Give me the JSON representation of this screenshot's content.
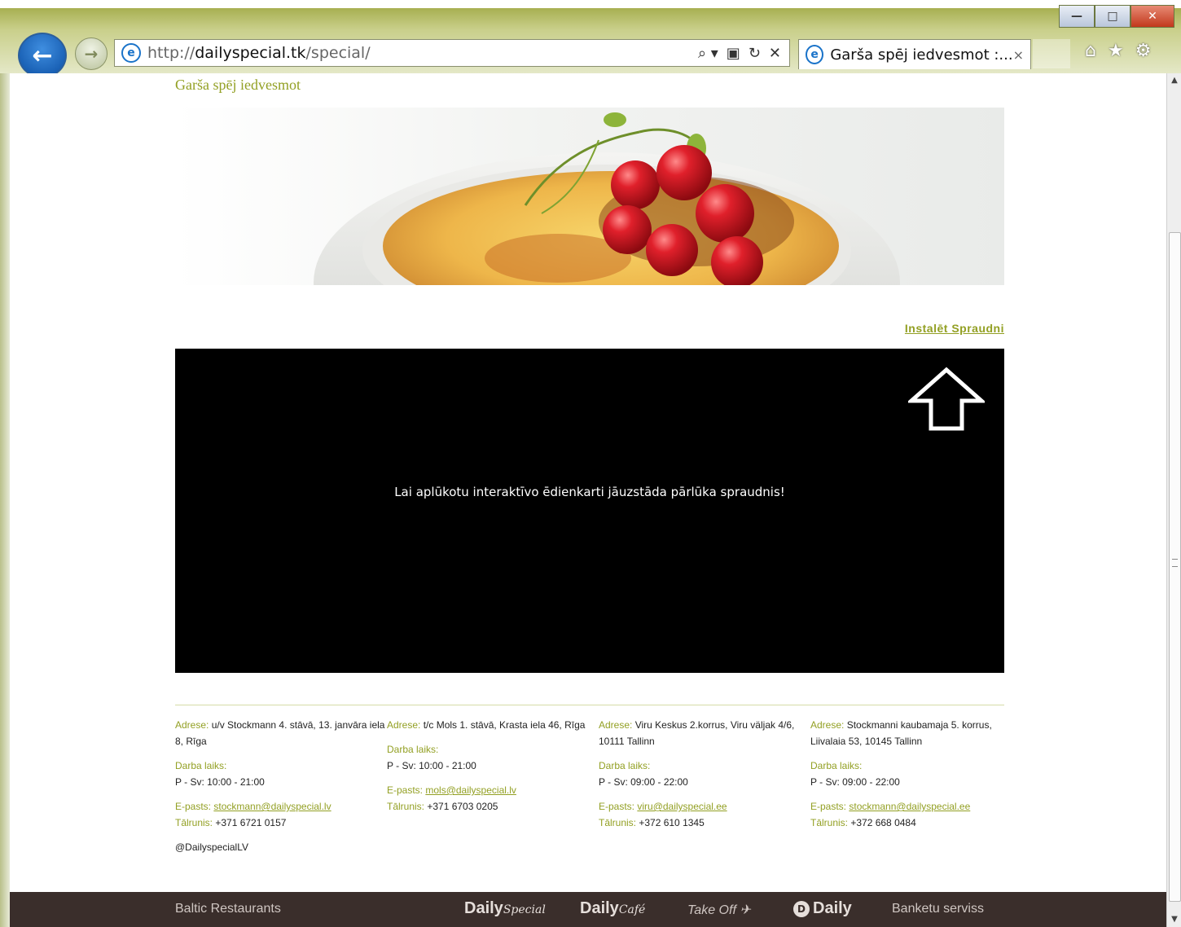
{
  "browser": {
    "url_scheme": "http://",
    "url_host": "dailyspecial.tk",
    "url_path": "/special/",
    "tab_title": "Garša spēj iedvesmot :...",
    "tab_close": "×",
    "addr_tools": {
      "search": "⌕ ▾",
      "compat": "▣",
      "refresh": "↻",
      "stop": "✕"
    },
    "window_buttons": {
      "minimize": "—",
      "restore": "□",
      "close": "✕"
    },
    "right_icons": {
      "home": "⌂",
      "favorites": "★",
      "tools": "⚙"
    }
  },
  "page": {
    "tagline": "Garša spēj iedvesmot",
    "install_link": "Instalēt Spraudni",
    "plugin_message": "Lai aplūkotu interaktīvo ēdienkarti jāuzstāda pārlūka spraudnis!"
  },
  "footer": {
    "columns": [
      {
        "address_label": "Adrese:",
        "address": " u/v Stockmann 4. stāvā, 13. janvāra iela 8, Rīga",
        "hours_label": "Darba laiks:",
        "hours": "P - Sv: 10:00 - 21:00",
        "email_label": "E-pasts:",
        "email": "stockmann@dailyspecial.lv",
        "phone_label": "Tālrunis:",
        "phone": " +371 6721 0157",
        "twitter": "@DailyspecialLV"
      },
      {
        "address_label": "Adrese:",
        "address": " t/c Mols 1. stāvā, Krasta iela 46, Rīga",
        "hours_label": "Darba laiks:",
        "hours": "P - Sv: 10:00 - 21:00",
        "email_label": "E-pasts:",
        "email": "mols@dailyspecial.lv",
        "phone_label": "Tālrunis:",
        "phone": " +371 6703 0205"
      },
      {
        "address_label": "Adrese:",
        "address": " Viru Keskus 2.korrus, Viru väljak 4/6, 10111 Tallinn",
        "hours_label": "Darba laiks:",
        "hours": "P - Sv: 09:00 - 22:00",
        "email_label": "E-pasts:",
        "email": "viru@dailyspecial.ee",
        "phone_label": "Tālrunis:",
        "phone": " +372 610 1345"
      },
      {
        "address_label": "Adrese:",
        "address": " Stockmanni kaubamaja 5. korrus, Liivalaia 53, 10145 Tallinn",
        "hours_label": "Darba laiks:",
        "hours": "P - Sv: 09:00 - 22:00",
        "email_label": "E-pasts:",
        "email": "stockmann@dailyspecial.ee",
        "phone_label": "Tālrunis:",
        "phone": " +372 668 0484"
      }
    ],
    "bottom_bar": {
      "baltic": "Baltic Restaurants",
      "daily_special_a": "Daily",
      "daily_special_b": "Special",
      "daily_cafe_a": "Daily",
      "daily_cafe_b": "Café",
      "take_off": "Take Off",
      "take_off_plane": "✈",
      "daily_circle": "D",
      "daily": "Daily",
      "banketu": "Banketu serviss"
    }
  },
  "colors": {
    "accent": "#93a024",
    "bottom_bar": "#3a2e2b",
    "plugin_bg": "#000000"
  }
}
